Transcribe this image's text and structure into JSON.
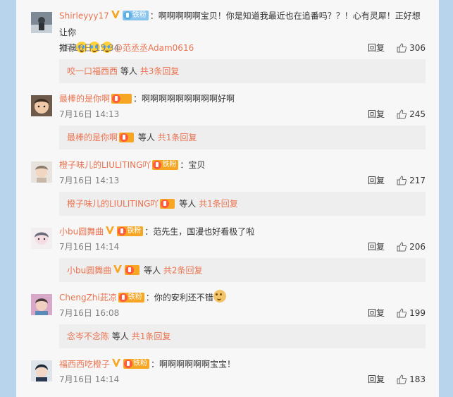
{
  "comments": [
    {
      "username": "Shirleyyy17",
      "fan_badge": "铁粉",
      "text_part1": "：啊啊啊啊啊宝贝！你是知道我最近也在追番吗？？！心有灵犀！正好想让你",
      "text_part2": "推荐",
      "mention": "@范丞丞Adam0616",
      "time": "7月16日 15:34",
      "reply_label": "回复",
      "likes": "306",
      "sub_user": "咬一口福西西",
      "sub_mid": "等人",
      "sub_more": "共3条回复"
    },
    {
      "username": "最棒的是你啊",
      "fan_badge": "",
      "text_part1": "：啊啊啊啊啊啊啊啊啊好啊",
      "time": "7月16日 14:13",
      "reply_label": "回复",
      "likes": "245",
      "sub_user": "最棒的是你啊",
      "sub_mid": "等人",
      "sub_more": "共1条回复"
    },
    {
      "username": "橙子味儿的LIULITING吖",
      "fan_badge": "铁粉",
      "text_part1": "：宝贝",
      "time": "7月16日 14:13",
      "reply_label": "回复",
      "likes": "217",
      "sub_user": "橙子味儿的LIULITING吖",
      "sub_mid": "等人",
      "sub_more": "共1条回复"
    },
    {
      "username": "小bu圆舞曲",
      "fan_badge": "铁粉",
      "text_part1": "：范先生，国漫也好看极了啦",
      "time": "7月16日 14:14",
      "reply_label": "回复",
      "likes": "206",
      "sub_user": "小bu圆舞曲",
      "sub_mid": "等人",
      "sub_more": "共2条回复"
    },
    {
      "username": "ChengZhi茈凉",
      "fan_badge": "铁粉",
      "text_part1": "：你的安利还不错",
      "time": "7月16日 16:08",
      "reply_label": "回复",
      "likes": "199",
      "sub_user": "念岑不念陈",
      "sub_mid": "等人",
      "sub_more": "共1条回复"
    },
    {
      "username": "福西西吃橙子",
      "fan_badge": "铁粉",
      "text_part1": "：啊啊啊啊啊啊宝宝！",
      "time": "7月16日 14:14",
      "reply_label": "回复",
      "likes": "183"
    }
  ],
  "colors": {
    "username": "#eb7350",
    "background": "#b7d4ec",
    "panel": "#f7f7f7",
    "sub_bg": "#eeeeee",
    "time": "#808080"
  }
}
